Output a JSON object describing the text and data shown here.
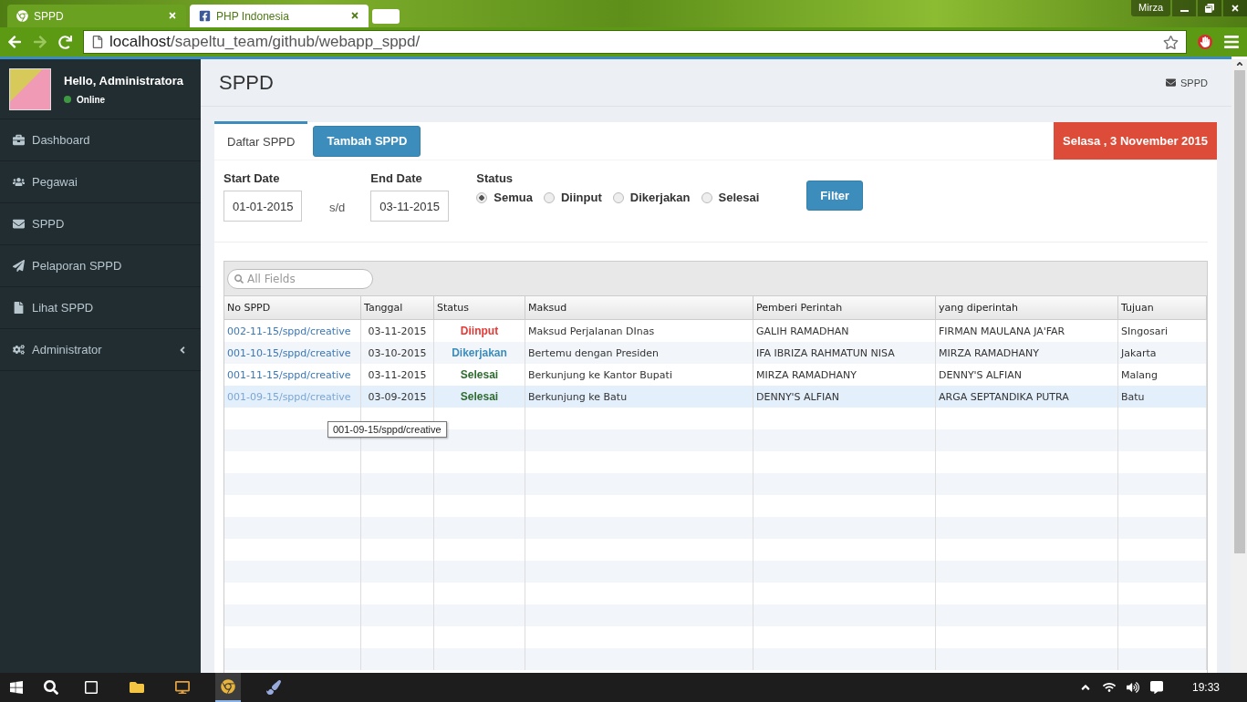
{
  "browser": {
    "tabs": [
      {
        "label": "SPPD",
        "selected": true
      },
      {
        "label": "PHP Indonesia",
        "selected": false
      }
    ],
    "profile": "Mirza",
    "url_host": "localhost",
    "url_path": "/sapeltu_team/github/webapp_sppd/"
  },
  "sidebar": {
    "greeting": "Hello, Administratora",
    "status": "Online",
    "items": [
      {
        "label": "Dashboard",
        "kind": "link"
      },
      {
        "label": "Pegawai",
        "kind": "link"
      },
      {
        "label": "SPPD",
        "kind": "link"
      },
      {
        "label": "Pelaporan SPPD",
        "kind": "link"
      },
      {
        "label": "Lihat SPPD",
        "kind": "link"
      },
      {
        "label": "Administrator",
        "kind": "submenu"
      }
    ]
  },
  "page": {
    "title": "SPPD",
    "breadcrumb": "SPPD"
  },
  "tabs": [
    {
      "label": "Daftar SPPD",
      "selected": true
    },
    {
      "label": "Tambah SPPD",
      "selected": false
    }
  ],
  "date_badge": "Selasa , 3 November 2015",
  "filter": {
    "start_label": "Start Date",
    "start_value": "01-01-2015",
    "separator": "s/d",
    "end_label": "End Date",
    "end_value": "03-11-2015",
    "status_label": "Status",
    "options": [
      {
        "label": "Semua",
        "selected": true
      },
      {
        "label": "Diinput",
        "selected": false
      },
      {
        "label": "Dikerjakan",
        "selected": false
      },
      {
        "label": "Selesai",
        "selected": false
      }
    ],
    "button": "Filter"
  },
  "table": {
    "search_placeholder": "All Fields",
    "columns": [
      "No SPPD",
      "Tanggal",
      "Status",
      "Maksud",
      "Pemberi Perintah",
      "yang diperintah",
      "Tujuan"
    ],
    "rows": [
      {
        "no": "002-11-15/sppd/creative",
        "tanggal": "03-11-2015",
        "status": "Diinput",
        "color": "#e53935",
        "maksud": "Maksud Perjalanan DInas",
        "pemberi": "GALIH RAMADHAN",
        "diperintah": "FIRMAN MAULANA JA'FAR",
        "tujuan": "SIngosari",
        "selected": false
      },
      {
        "no": "001-10-15/sppd/creative",
        "tanggal": "03-10-2015",
        "status": "Dikerjakan",
        "color": "#3c8dbc",
        "maksud": "Bertemu dengan Presiden",
        "pemberi": "IFA IBRIZA RAHMATUN NISA",
        "diperintah": "MIRZA RAMADHANY",
        "tujuan": "Jakarta",
        "selected": false
      },
      {
        "no": "001-11-15/sppd/creative",
        "tanggal": "03-11-2015",
        "status": "Selesai",
        "color": "#2e6b30",
        "maksud": "Berkunjung ke Kantor Bupati",
        "pemberi": "MIRZA RAMADHANY",
        "diperintah": "DENNY'S ALFIAN",
        "tujuan": "Malang",
        "selected": false
      },
      {
        "no": "001-09-15/sppd/creative",
        "tanggal": "03-09-2015",
        "status": "Selesai",
        "color": "#2e6b30",
        "maksud": "Berkunjung ke Batu",
        "pemberi": "DENNY'S ALFIAN",
        "diperintah": "ARGA SEPTANDIKA PUTRA",
        "tujuan": "Batu",
        "selected": true
      }
    ],
    "tooltip": "001-09-15/sppd/creative"
  },
  "taskbar": {
    "time": "19:33"
  }
}
